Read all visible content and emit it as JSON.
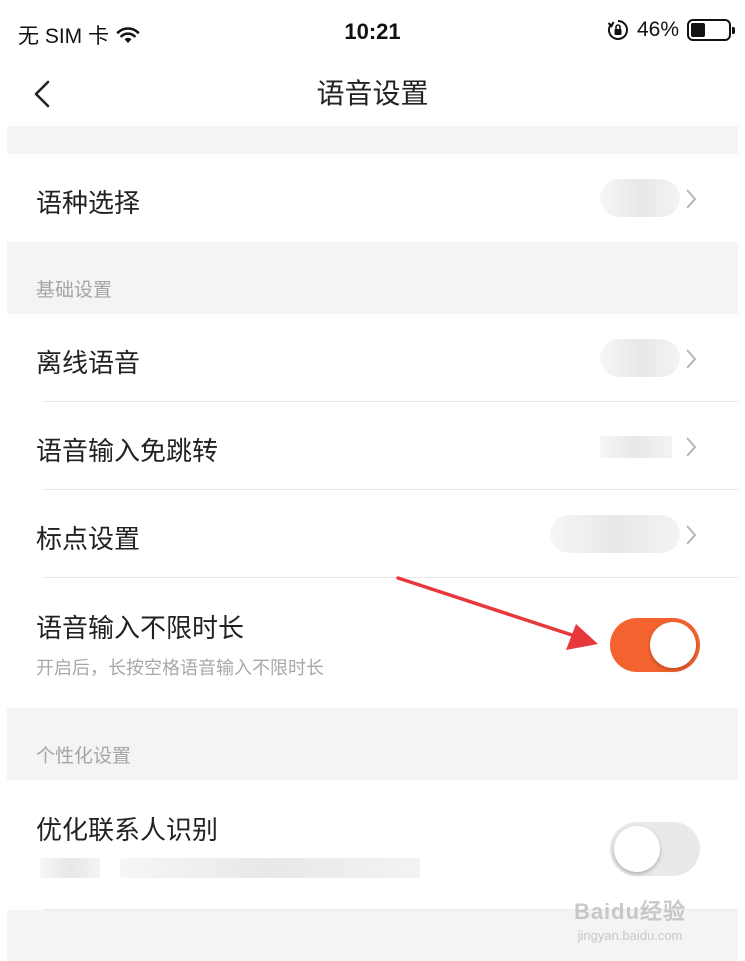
{
  "status_bar": {
    "carrier": "无 SIM 卡",
    "time": "10:21",
    "battery_percent": "46%",
    "battery_level": 0.46
  },
  "nav": {
    "title": "语音设置"
  },
  "rows": {
    "language": {
      "label": "语种选择"
    },
    "offline": {
      "label": "离线语音"
    },
    "no_jump": {
      "label": "语音输入免跳转"
    },
    "punctuation": {
      "label": "标点设置"
    },
    "unlimited": {
      "label": "语音输入不限时长",
      "description": "开启后，长按空格语音输入不限时长",
      "enabled": true
    },
    "contacts": {
      "label": "优化联系人识别",
      "enabled": false
    }
  },
  "sections": {
    "basic": "基础设置",
    "personal": "个性化设置"
  },
  "watermark": {
    "text": "Baidu经验",
    "url": "jingyan.baidu.com"
  },
  "colors": {
    "accent": "#f4632f",
    "background_gray": "#f4f4f4",
    "toggle_off": "#e9e9e9",
    "annotation_arrow": "#e8383b"
  }
}
